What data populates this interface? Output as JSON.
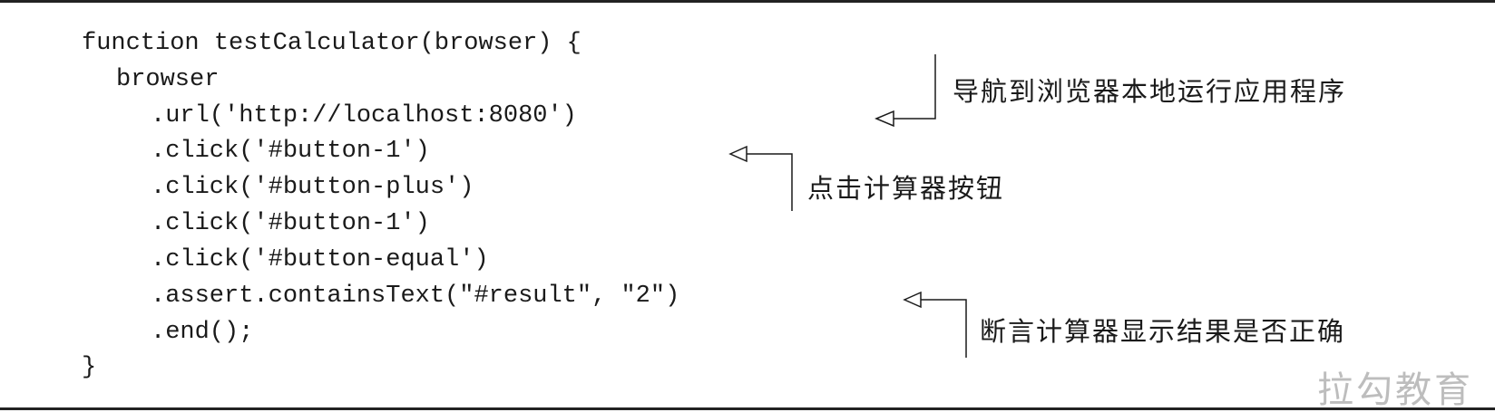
{
  "code": {
    "lines": [
      "function testCalculator(browser) {",
      "browser",
      ".url('http://localhost:8080')",
      ".click('#button-1')",
      ".click('#button-plus')",
      ".click('#button-1')",
      ".click('#button-equal')",
      ".assert.containsText(\"#result\", \"2\")",
      ".end();",
      "}"
    ]
  },
  "annotations": {
    "navigate": "导航到浏览器本地运行应用程序",
    "click_buttons": "点击计算器按钮",
    "assert_result": "断言计算器显示结果是否正确"
  },
  "watermark": "拉勾教育",
  "colors": {
    "text": "#1a1a1a",
    "rule": "#222222",
    "watermark": "#bdbdbd"
  }
}
